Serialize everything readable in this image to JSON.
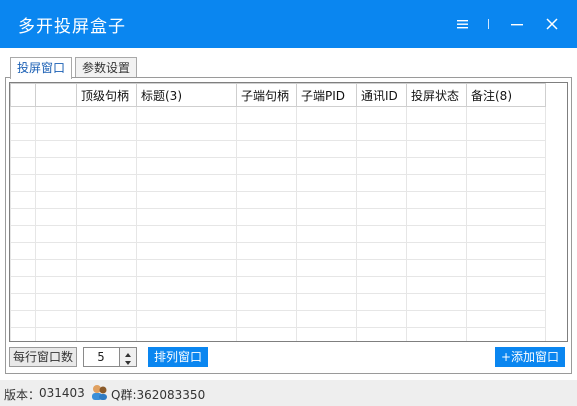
{
  "window": {
    "title": "多开投屏盒子",
    "accent_color": "#0a86f0",
    "controls": [
      "menu-icon",
      "divider",
      "minimize-icon",
      "close-icon"
    ]
  },
  "tabs": [
    {
      "label": "投屏窗口",
      "active": true
    },
    {
      "label": "参数设置",
      "active": false
    }
  ],
  "table": {
    "columns": [
      "",
      "",
      "顶级句柄",
      "标题(3)",
      "子端句柄",
      "子端PID",
      "通讯ID",
      "投屏状态",
      "备注(8)"
    ],
    "rows": []
  },
  "controls": {
    "per_row_label": "每行窗口数",
    "per_row_value": "5",
    "arrange_button": "排列窗口",
    "add_window_button": "+添加窗口"
  },
  "status": {
    "version_label": "版本：",
    "version_value": "031403",
    "qq_group": "Q群:362083350"
  }
}
